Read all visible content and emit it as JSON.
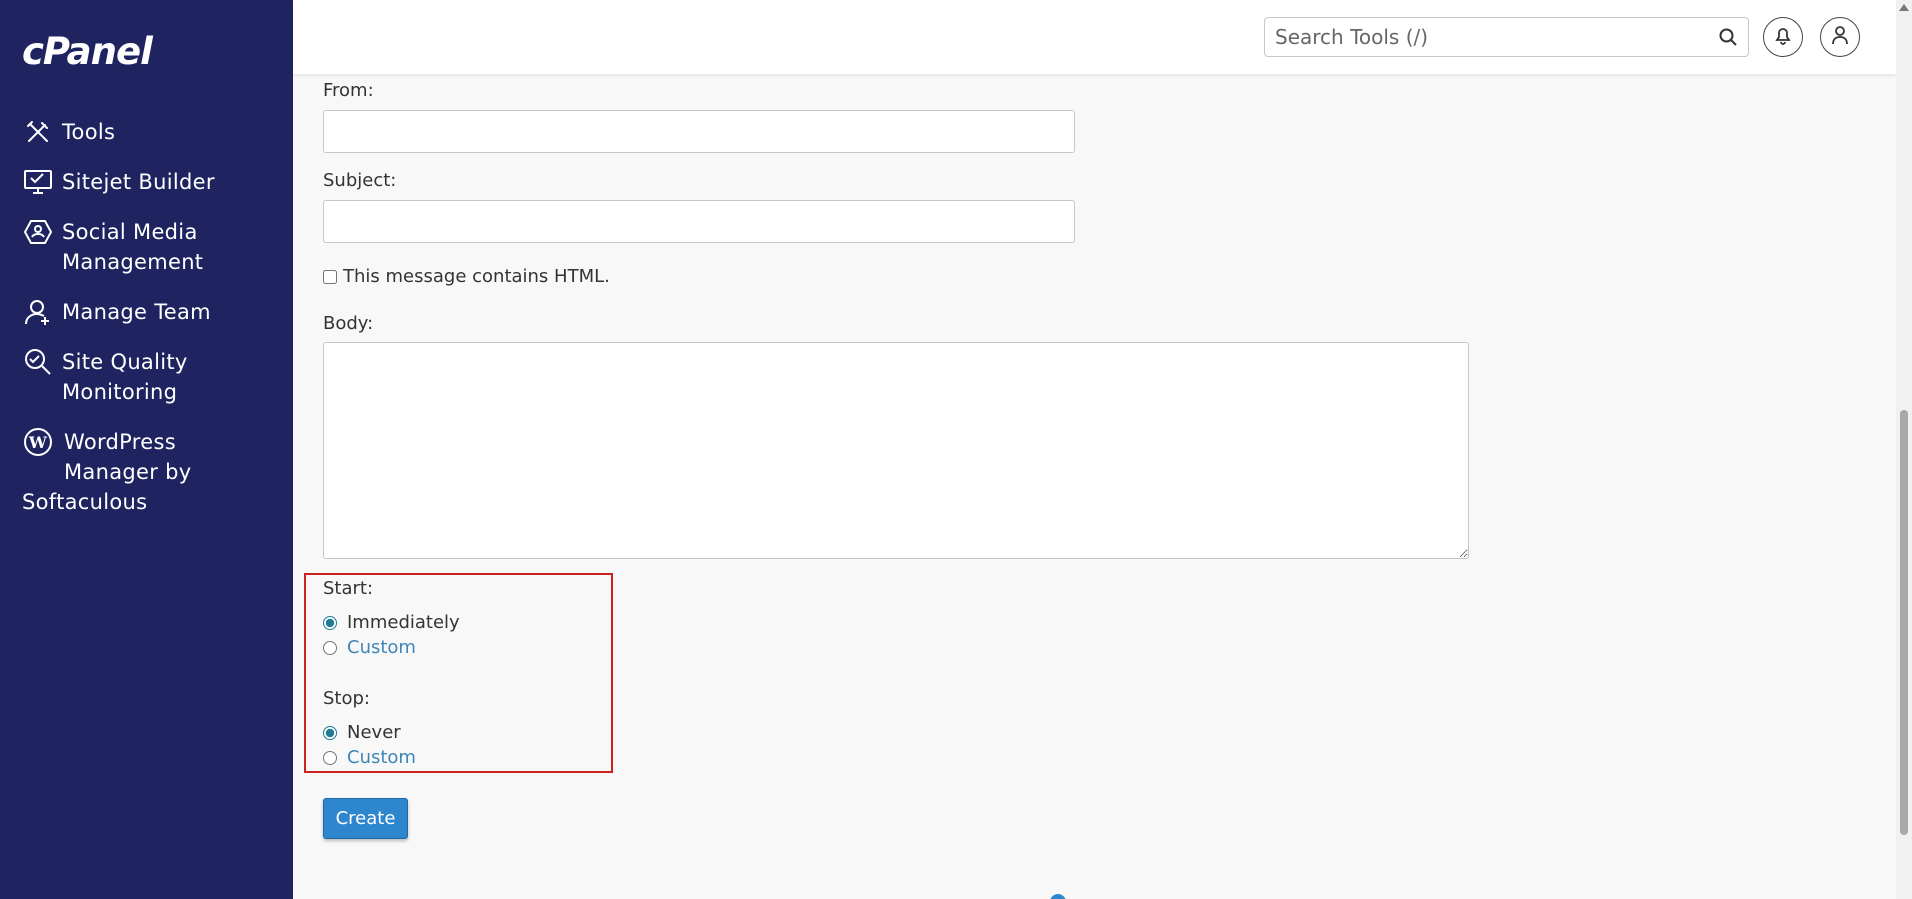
{
  "sidebar": {
    "logo": "cPanel",
    "items": [
      {
        "label": "Tools",
        "icon": "tools-icon"
      },
      {
        "label": "Sitejet Builder",
        "icon": "monitor-icon"
      },
      {
        "label": "Social Media Management",
        "icon": "social-media-icon"
      },
      {
        "label": "Manage Team",
        "icon": "team-icon"
      },
      {
        "label": "Site Quality Monitoring",
        "icon": "search-quality-icon"
      },
      {
        "label_line1": "WordPress",
        "label_line2": "Manager by",
        "label_line3": "Softaculous",
        "icon": "wordpress-icon"
      }
    ]
  },
  "header": {
    "search_placeholder": "Search Tools (/)"
  },
  "form": {
    "from_label": "From:",
    "from_value": "",
    "subject_label": "Subject:",
    "subject_value": "",
    "html_checkbox_label": "This message contains HTML.",
    "html_checked": false,
    "body_label": "Body:",
    "body_value": "",
    "start_label": "Start:",
    "start_immediately": "Immediately",
    "start_custom": "Custom",
    "stop_label": "Stop:",
    "stop_never": "Never",
    "stop_custom": "Custom",
    "create_button": "Create"
  },
  "colors": {
    "sidebar_bg": "#1f2460",
    "primary": "#2e86cf",
    "link": "#3d86b8",
    "highlight_border": "#cc2222"
  }
}
